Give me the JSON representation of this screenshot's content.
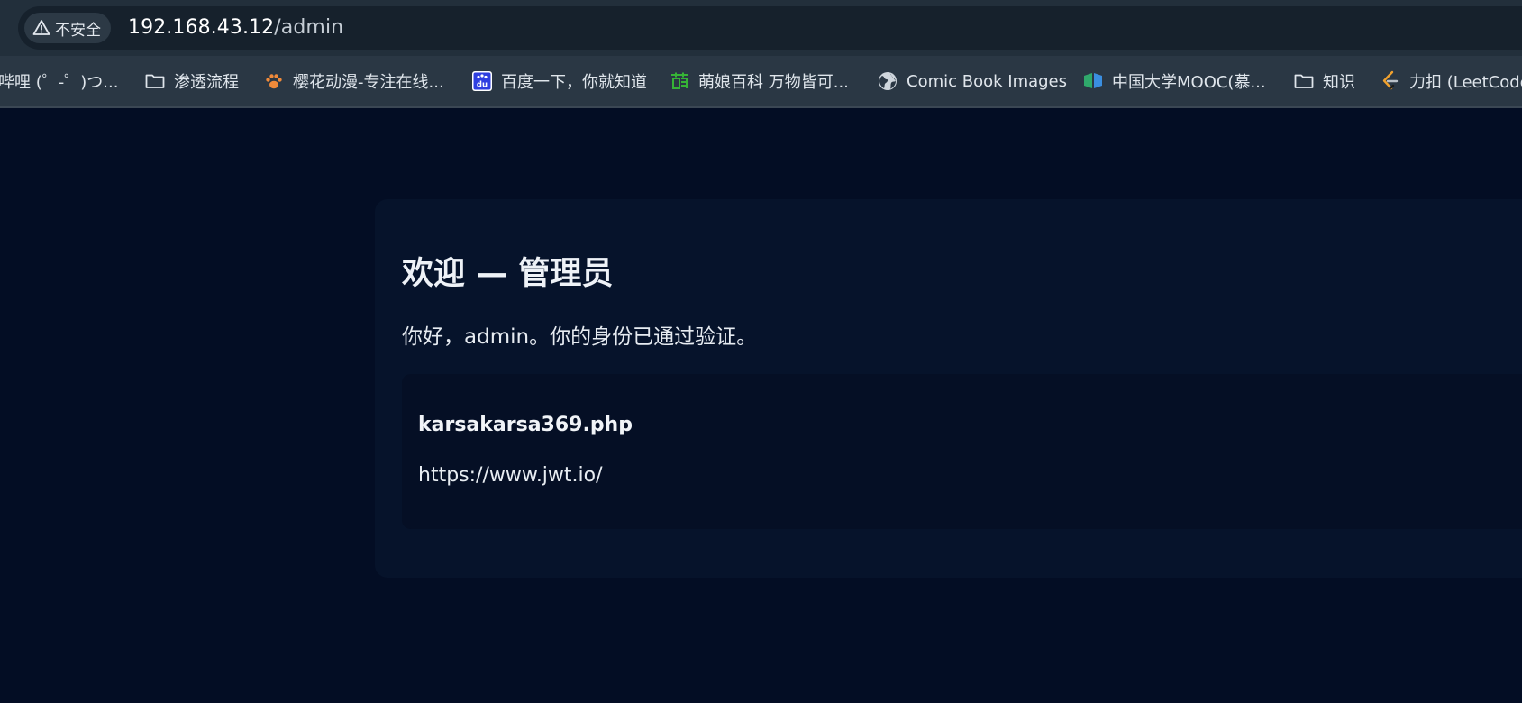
{
  "address_bar": {
    "security_label": "不安全",
    "url_host": "192.168.43.12",
    "url_path": "/admin"
  },
  "bookmarks": [
    {
      "label": "哔哩 (゜-゜)つ...",
      "icon": "bilibili-icon"
    },
    {
      "label": "渗透流程",
      "icon": "folder-icon"
    },
    {
      "label": "樱花动漫-专注在线...",
      "icon": "paw-icon",
      "color": "#f08a3a"
    },
    {
      "label": "百度一下，你就知道",
      "icon": "baidu-icon",
      "color": "#2f3fe0"
    },
    {
      "label": "萌娘百科 万物皆可...",
      "icon": "moegirl-icon",
      "color": "#36b336"
    },
    {
      "label": "Comic Book Images",
      "icon": "globe-icon"
    },
    {
      "label": "中国大学MOOC(慕...",
      "icon": "mooc-icon",
      "color": "#2fa86b"
    },
    {
      "label": "知识",
      "icon": "folder-icon"
    },
    {
      "label": "力扣 (LeetCode",
      "icon": "leetcode-icon",
      "color": "#f0a12e"
    }
  ],
  "page": {
    "title": "欢迎 — 管理员",
    "greeting": "你好，admin。你的身份已通过验证。",
    "info": {
      "filename": "karsakarsa369.php",
      "link": "https://www.jwt.io/"
    }
  },
  "colors": {
    "page_background": "#030d24",
    "card_background": "#06132b",
    "browser_chrome": "#2a3744"
  }
}
